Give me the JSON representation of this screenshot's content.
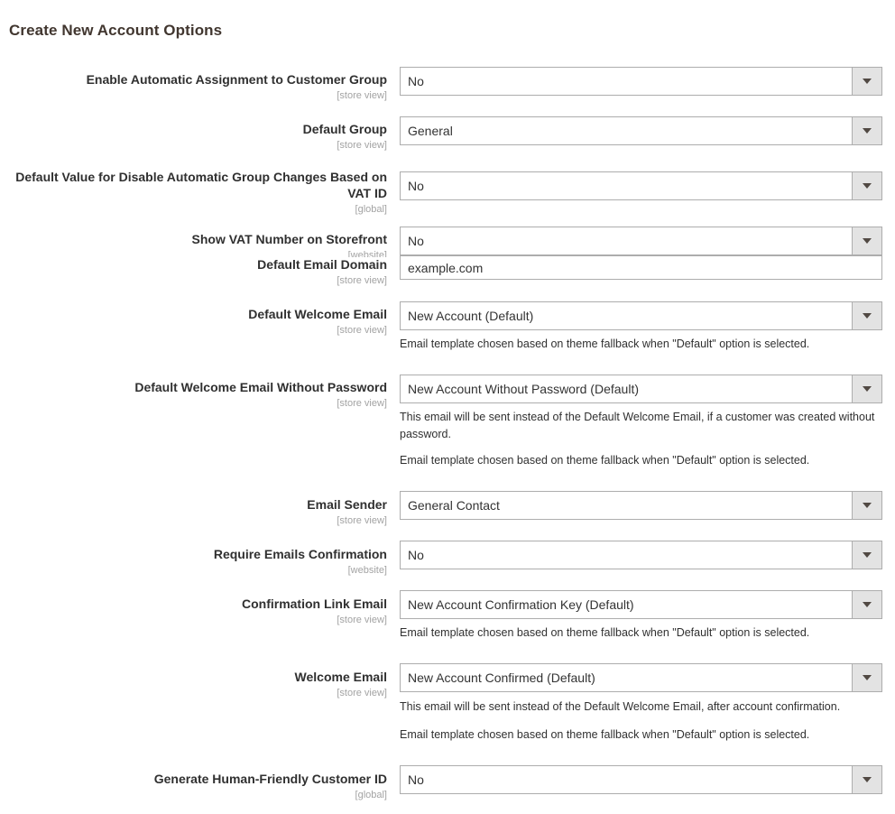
{
  "section": {
    "title": "Create New Account Options"
  },
  "scope_labels": {
    "store_view": "[store view]",
    "website": "[website]",
    "global": "[global]"
  },
  "notes": {
    "template_fallback": "Email template chosen based on theme fallback when \"Default\" option is selected.",
    "without_password": "This email will be sent instead of the Default Welcome Email, if a customer was created without password.",
    "after_confirmation": "This email will be sent instead of the Default Welcome Email, after account confirmation."
  },
  "fields": [
    {
      "id": "auto-assignment-customer-group",
      "label": "Enable Automatic Assignment to Customer Group",
      "scope": "[store view]",
      "type": "select",
      "value": "No"
    },
    {
      "id": "default-group",
      "label": "Default Group",
      "scope": "[store view]",
      "type": "select",
      "value": "General"
    },
    {
      "id": "disable-auto-group-change-vat-id",
      "label": "Default Value for Disable Automatic Group Changes Based on VAT ID",
      "scope": "[global]",
      "type": "select",
      "value": "No"
    },
    {
      "id": "show-vat-number-storefront",
      "label": "Show VAT Number on Storefront",
      "scope": "[website]",
      "type": "select",
      "value": "No"
    },
    {
      "id": "default-email-domain",
      "label": "Default Email Domain",
      "scope": "[store view]",
      "type": "text",
      "value": "example.com"
    },
    {
      "id": "default-welcome-email",
      "label": "Default Welcome Email",
      "scope": "[store view]",
      "type": "select",
      "value": "New Account (Default)"
    },
    {
      "id": "default-welcome-email-without-password",
      "label": "Default Welcome Email Without Password",
      "scope": "[store view]",
      "type": "select",
      "value": "New Account Without Password (Default)"
    },
    {
      "id": "email-sender",
      "label": "Email Sender",
      "scope": "[store view]",
      "type": "select",
      "value": "General Contact"
    },
    {
      "id": "require-emails-confirmation",
      "label": "Require Emails Confirmation",
      "scope": "[website]",
      "type": "select",
      "value": "No"
    },
    {
      "id": "confirmation-link-email",
      "label": "Confirmation Link Email",
      "scope": "[store view]",
      "type": "select",
      "value": "New Account Confirmation Key (Default)"
    },
    {
      "id": "welcome-email",
      "label": "Welcome Email",
      "scope": "[store view]",
      "type": "select",
      "value": "New Account Confirmed (Default)"
    },
    {
      "id": "generate-human-friendly-customer-id",
      "label": "Generate Human-Friendly Customer ID",
      "scope": "[global]",
      "type": "select",
      "value": "No"
    }
  ]
}
